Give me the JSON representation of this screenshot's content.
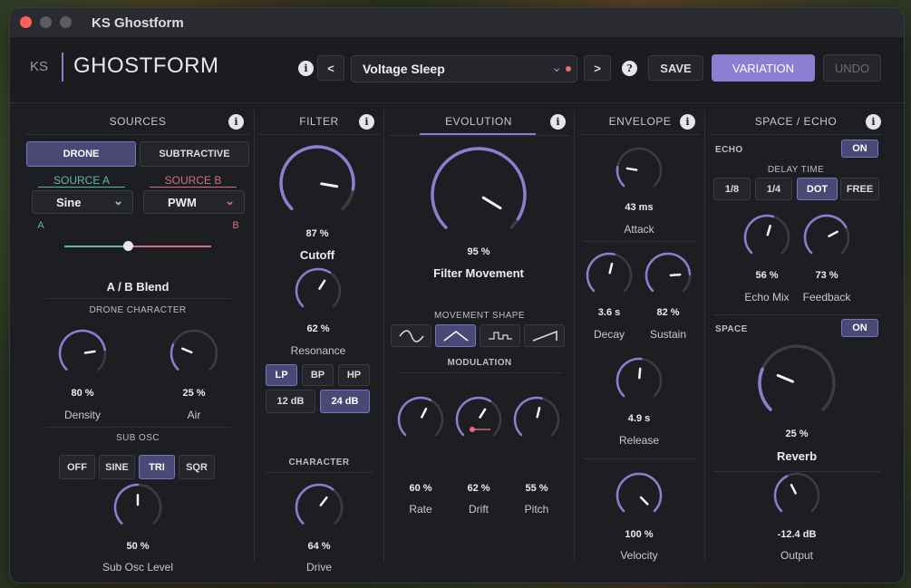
{
  "window": {
    "title": "KS Ghostform"
  },
  "header": {
    "brand": "KS",
    "product": "GHOSTFORM",
    "info": "i",
    "prev": "<",
    "next": ">",
    "help": "?",
    "preset_name": "Voltage Sleep",
    "save": "SAVE",
    "variation": "VARIATION",
    "undo": "UNDO"
  },
  "colors": {
    "accent": "#8a7fd0",
    "source_a": "#5fb8a6",
    "source_b": "#d0707c",
    "dirty_dot": "#e86b7a"
  },
  "sources": {
    "title": "SOURCES",
    "mode_drone": "DRONE",
    "mode_subtractive": "SUBTRACTIVE",
    "selected_mode": "DRONE",
    "source_a_label": "SOURCE A",
    "source_b_label": "SOURCE B",
    "source_a_wave": "Sine",
    "source_b_wave": "PWM",
    "blend_a": "A",
    "blend_b": "B",
    "blend_title": "A / B Blend",
    "blend_value": 0.43,
    "drone_character": "DRONE CHARACTER",
    "density_value": "80 %",
    "density_label": "Density",
    "density_fraction": 0.8,
    "air_value": "25 %",
    "air_label": "Air",
    "air_fraction": 0.25,
    "sub_osc": "SUB OSC",
    "sub_off": "OFF",
    "sub_sine": "SINE",
    "sub_tri": "TRI",
    "sub_sqr": "SQR",
    "selected_sub": "TRI",
    "sub_level_value": "50 %",
    "sub_level_label": "Sub Osc Level",
    "sub_level_fraction": 0.5
  },
  "filter": {
    "title": "FILTER",
    "cutoff_value": "87 %",
    "cutoff_label": "Cutoff",
    "cutoff_fraction": 0.87,
    "resonance_value": "62 %",
    "resonance_label": "Resonance",
    "resonance_fraction": 0.62,
    "lp": "LP",
    "bp": "BP",
    "hp": "HP",
    "selected_type": "LP",
    "slope_12": "12 dB",
    "slope_24": "24 dB",
    "selected_slope": "24 dB",
    "character": "CHARACTER",
    "drive_value": "64 %",
    "drive_label": "Drive",
    "drive_fraction": 0.64
  },
  "evolution": {
    "title": "EVOLUTION",
    "movement_value": "95 %",
    "movement_label": "Filter Movement",
    "movement_fraction": 0.95,
    "movement_shape": "MOVEMENT SHAPE",
    "selected_shape": 1,
    "modulation": "MODULATION",
    "rate_value": "60 %",
    "rate_label": "Rate",
    "rate_fraction": 0.6,
    "drift_value": "62 %",
    "drift_label": "Drift",
    "drift_fraction": 0.62,
    "pitch_value": "55 %",
    "pitch_label": "Pitch",
    "pitch_fraction": 0.55
  },
  "envelope": {
    "title": "ENVELOPE",
    "attack_value": "43 ms",
    "attack_label": "Attack",
    "attack_fraction": 0.2,
    "decay_value": "3.6 s",
    "decay_label": "Decay",
    "decay_fraction": 0.55,
    "sustain_value": "82 %",
    "sustain_label": "Sustain",
    "sustain_fraction": 0.82,
    "release_value": "4.9 s",
    "release_label": "Release",
    "release_fraction": 0.52,
    "velocity_value": "100 %",
    "velocity_label": "Velocity",
    "velocity_fraction": 1.0
  },
  "space": {
    "title": "SPACE / ECHO",
    "echo": "ECHO",
    "echo_toggle": "ON",
    "delay_time": "DELAY TIME",
    "d18": "1/8",
    "d14": "1/4",
    "ddot": "DOT",
    "dfree": "FREE",
    "selected_delay": "DOT",
    "echo_mix_value": "56 %",
    "echo_mix_label": "Echo Mix",
    "echo_mix_fraction": 0.56,
    "feedback_value": "73 %",
    "feedback_label": "Feedback",
    "feedback_fraction": 0.73,
    "space": "SPACE",
    "space_toggle": "ON",
    "reverb_value": "25 %",
    "reverb_label": "Reverb",
    "reverb_fraction": 0.25,
    "output_value": "-12.4 dB",
    "output_label": "Output",
    "output_fraction": 0.4
  }
}
